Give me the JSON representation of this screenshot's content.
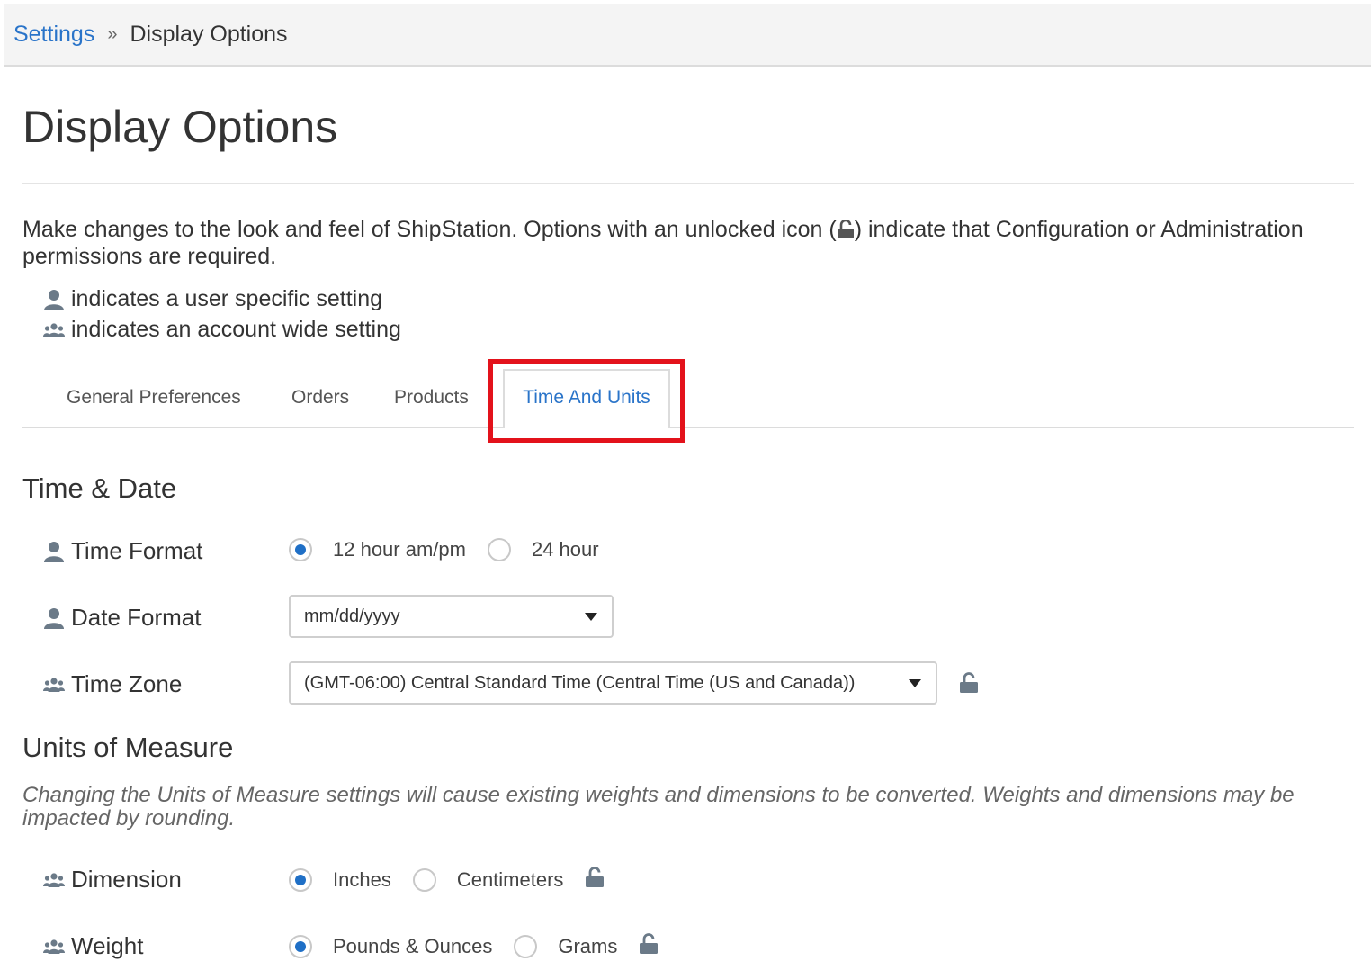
{
  "breadcrumb": {
    "parent": "Settings",
    "separator": "»",
    "current": "Display Options"
  },
  "page": {
    "title": "Display Options",
    "intro_before_icon": "Make changes to the look and feel of ShipStation. Options with an unlocked icon (",
    "intro_after_icon": ") indicate that Configuration or Administration permissions are required.",
    "legend_user": "indicates a user specific setting",
    "legend_account": "indicates an account wide setting"
  },
  "tabs": {
    "items": [
      "General Preferences",
      "Orders",
      "Products"
    ],
    "active": "Time And Units"
  },
  "time_date": {
    "heading": "Time & Date",
    "time_format": {
      "label": "Time Format",
      "options": [
        "12 hour am/pm",
        "24 hour"
      ],
      "selected": "12 hour am/pm"
    },
    "date_format": {
      "label": "Date Format",
      "value": "mm/dd/yyyy"
    },
    "time_zone": {
      "label": "Time Zone",
      "value": "(GMT-06:00) Central Standard Time (Central Time (US and Canada))"
    }
  },
  "units": {
    "heading": "Units of Measure",
    "note": "Changing the Units of Measure settings will cause existing weights and dimensions to be converted. Weights and dimensions may be impacted by rounding.",
    "dimension": {
      "label": "Dimension",
      "options": [
        "Inches",
        "Centimeters"
      ],
      "selected": "Inches"
    },
    "weight": {
      "label": "Weight",
      "options": [
        "Pounds & Ounces",
        "Grams"
      ],
      "selected": "Pounds & Ounces"
    }
  },
  "icons": {
    "user": "user-icon",
    "account": "users-icon",
    "lock": "unlocked-icon"
  },
  "colors": {
    "link": "#2a74c9",
    "highlight": "#e3121b",
    "radio_selected": "#1f6fc6"
  }
}
